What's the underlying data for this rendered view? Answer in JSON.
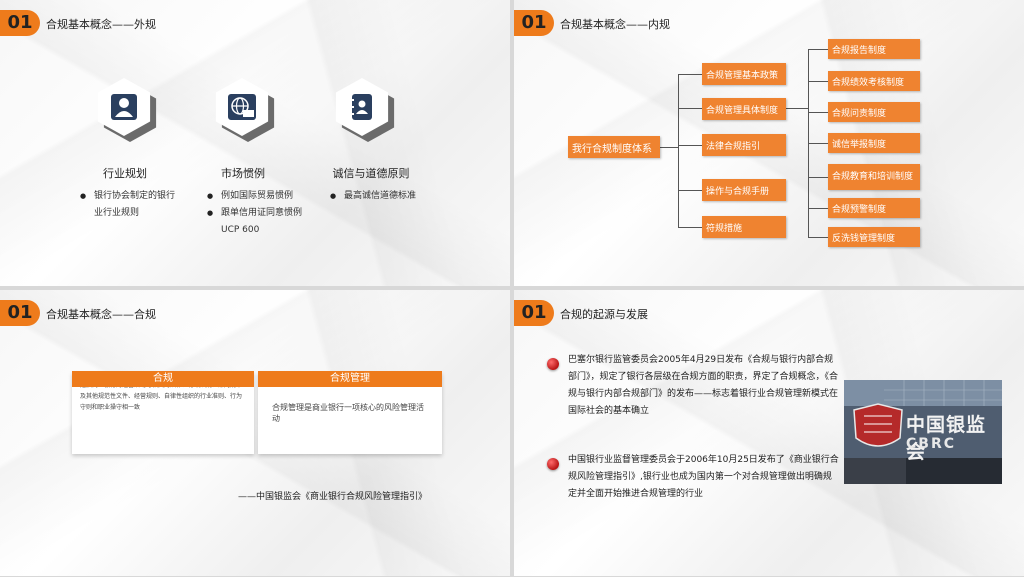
{
  "slide1": {
    "badge": "01",
    "title": "合规基本概念——外规",
    "columns": [
      {
        "icon": "person-icon",
        "title": "行业规划",
        "bullets": [
          "银行协会制定的银行业行业规则"
        ]
      },
      {
        "icon": "globe-icon",
        "title": "市场惯例",
        "bullets": [
          "例如国际贸易惯例",
          "跟单信用证同意惯例UCP 600"
        ]
      },
      {
        "icon": "address-book-icon",
        "title": "诚信与道德原则",
        "bullets": [
          "最高诚信道德标准"
        ]
      }
    ]
  },
  "slide2": {
    "badge": "01",
    "title": "合规基本概念——内规",
    "root": "我行合规制度体系",
    "level1": [
      "合规管理基本政策",
      "合规管理具体制度",
      "法律合规指引",
      "操作与合规手册",
      "符规措施"
    ],
    "level2": [
      "合规报告制度",
      "合规绩效考核制度",
      "合规问责制度",
      "诚信举报制度",
      "合规教育和培训制度",
      "合规预警制度",
      "反洗钱管理制度"
    ]
  },
  "slide3": {
    "badge": "01",
    "title": "合规基本概念——合规",
    "card1_head": "合规",
    "card1_body": "是指商业银行的经营活动与相关的法律、行政法规、部门规章及其他规范性文件、经营规则、自律性组织的行业准则、行为守则和职业操守相一致",
    "card2_head": "合规管理",
    "card2_body": "合规管理是商业银行一项核心的风险管理活动",
    "quote": "——中国银监会《商业银行合规风险管理指引》"
  },
  "slide4": {
    "badge": "01",
    "title": "合规的起源与发展",
    "para1": "巴塞尔银行监管委员会2005年4月29日发布《合规与银行内部合规部门》，规定了银行各层级在合规方面的职责，界定了合规概念，《合规与银行内部合规部门》的发布——标志着银行业合规管理新模式在国际社会的基本确立",
    "para2": "中国银行业监督管理委员会于2006年10月25日发布了《商业银行合规风险管理指引》,银行业也成为国内第一个对合规管理做出明确规定并全面开始推进合规管理的行业",
    "photo_sign": "中国银监会",
    "photo_logo": "CBRC"
  },
  "colors": {
    "accent": "#ee7b1b",
    "box": "#ef8330",
    "dot": "#c0171a"
  }
}
